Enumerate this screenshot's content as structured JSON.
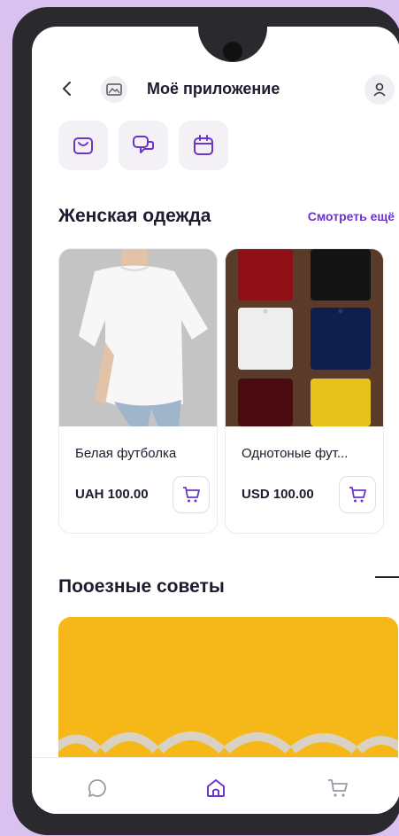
{
  "header": {
    "title": "Моё приложение"
  },
  "quick_actions": [
    {
      "icon": "shopping-bag-icon"
    },
    {
      "icon": "chat-icon"
    },
    {
      "icon": "calendar-icon"
    }
  ],
  "sections": {
    "womens_clothing": {
      "title": "Женская одежда",
      "see_more": "Смотреть ещё"
    },
    "tips": {
      "title": "Пооезные советы"
    }
  },
  "products": [
    {
      "name": "Белая футболка",
      "price": "UAH 100.00"
    },
    {
      "name": "Однотоные фут...",
      "price": "USD 100.00"
    }
  ],
  "bottom_nav": [
    {
      "icon": "chat-bubble-icon"
    },
    {
      "icon": "home-icon",
      "active": true
    },
    {
      "icon": "cart-icon"
    }
  ],
  "colors": {
    "accent": "#6a35c8",
    "background": "#d9c1f0",
    "banner": "#f6b818"
  }
}
